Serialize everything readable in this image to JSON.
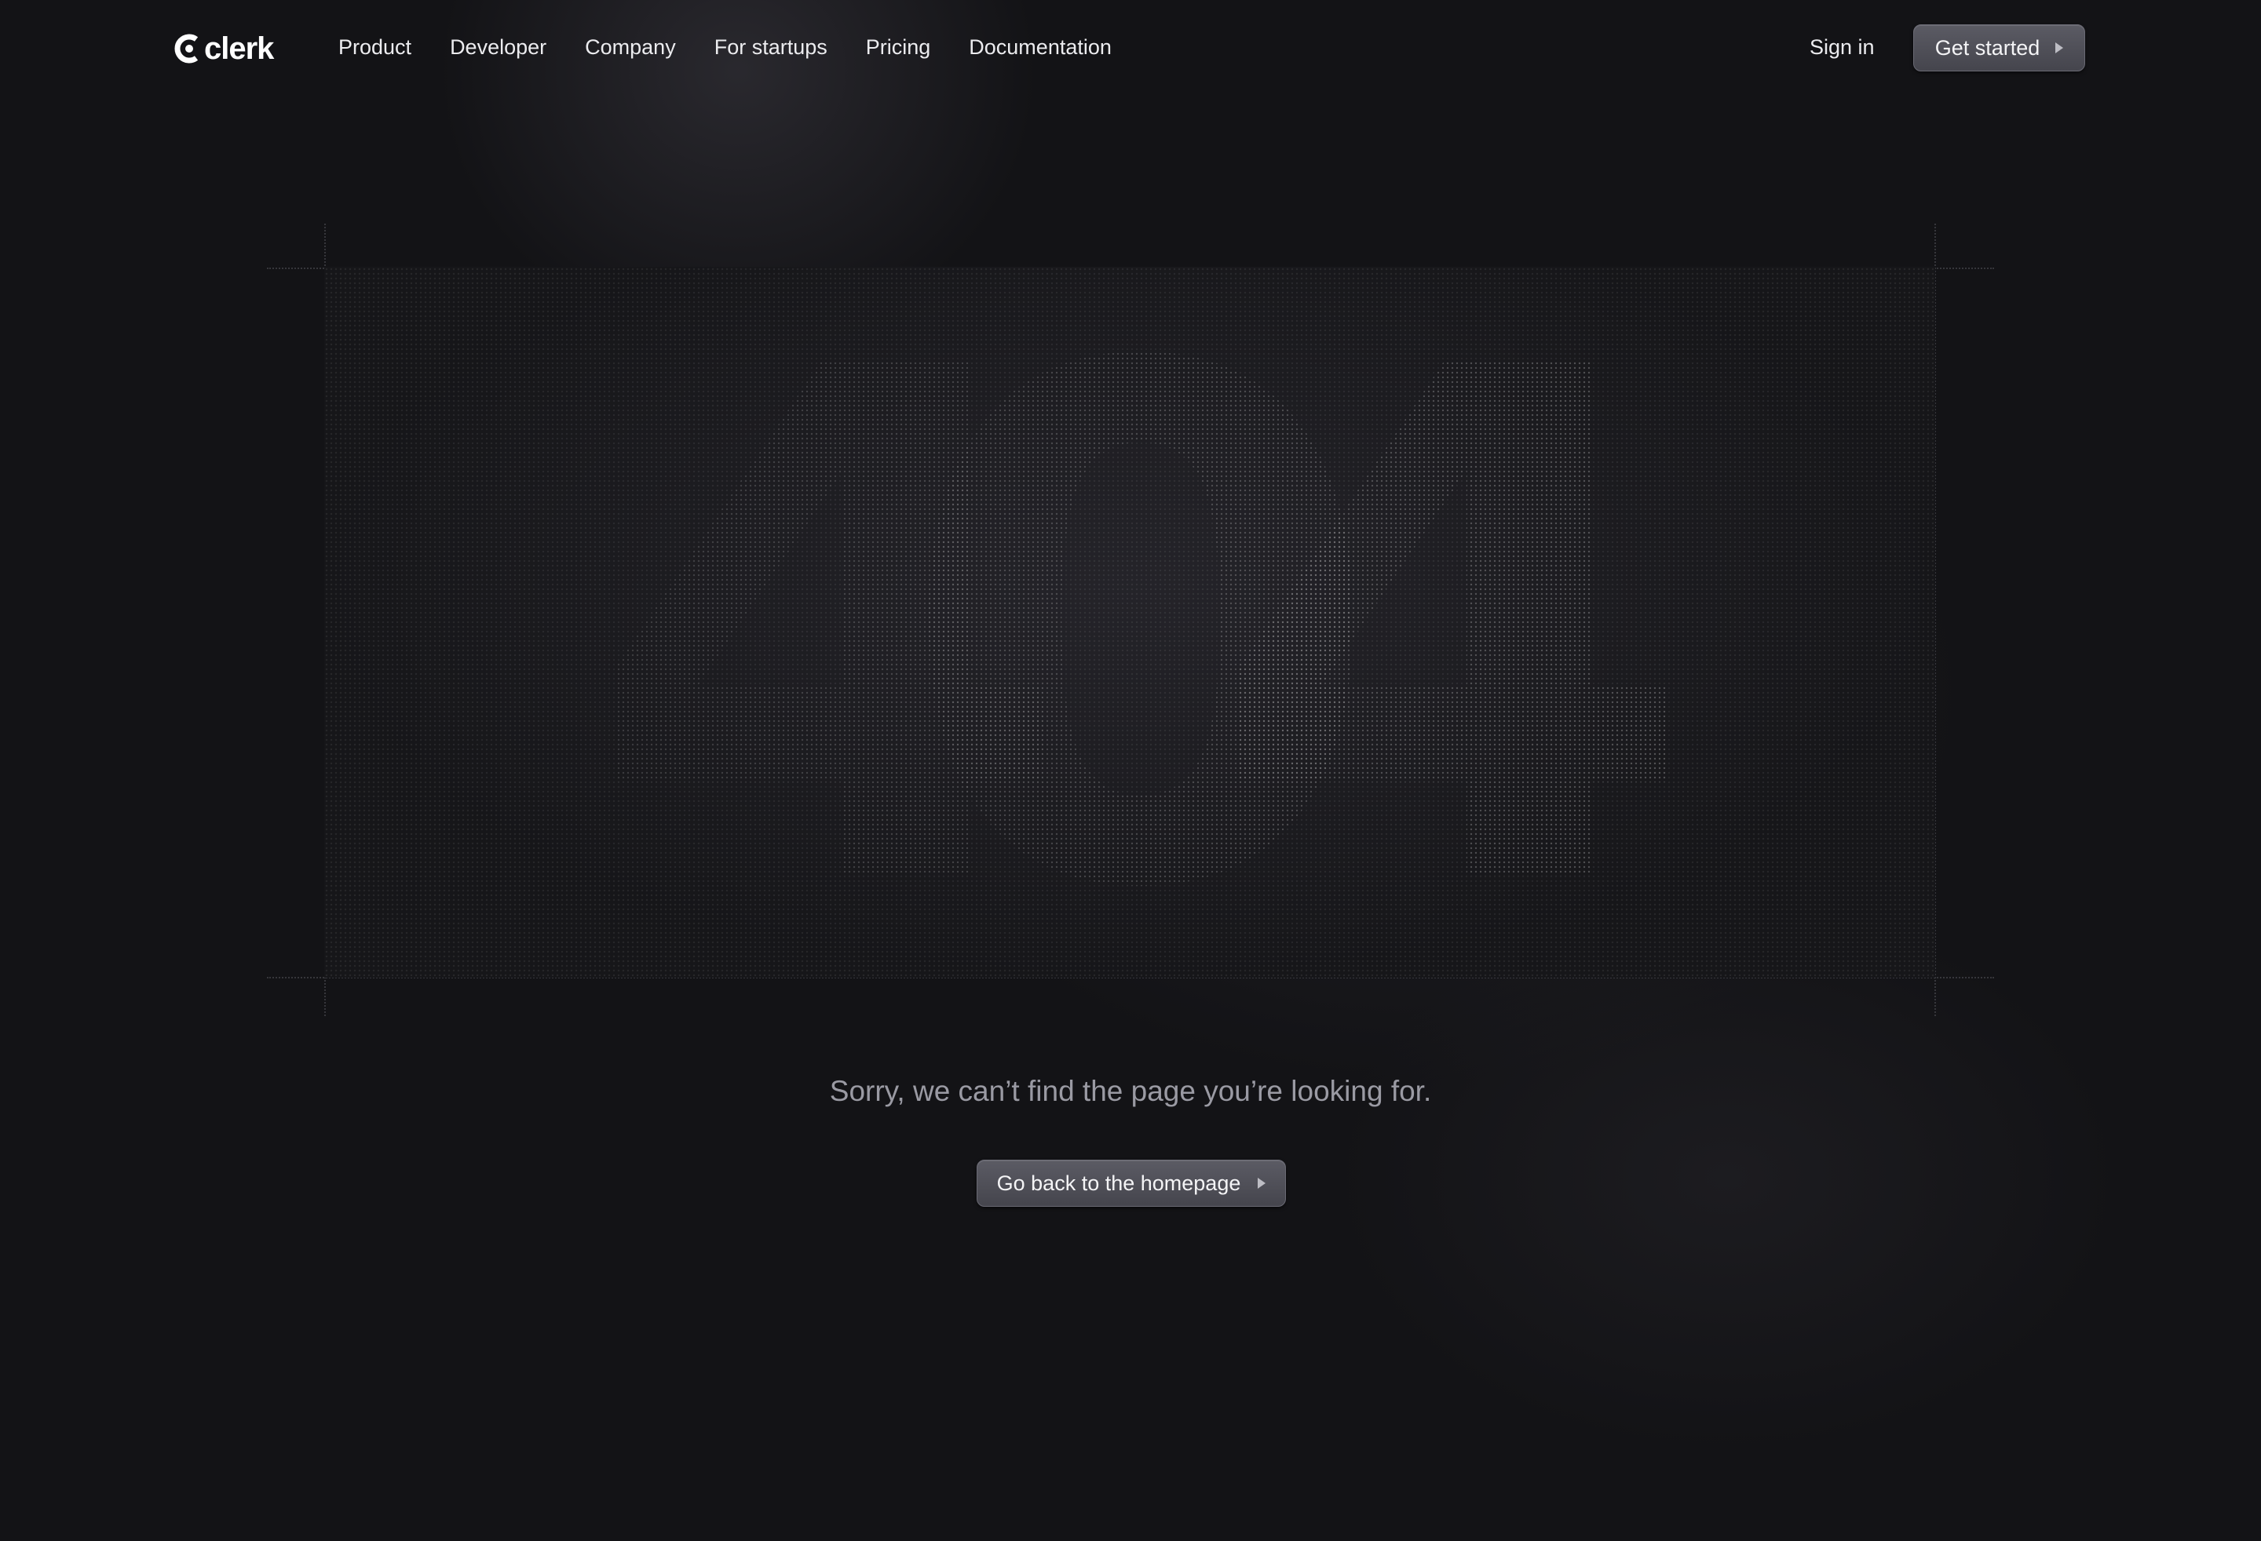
{
  "brand": {
    "name": "clerk",
    "logo_icon": "clerk-logo-icon"
  },
  "nav": {
    "items": [
      {
        "label": "Product"
      },
      {
        "label": "Developer"
      },
      {
        "label": "Company"
      },
      {
        "label": "For startups"
      },
      {
        "label": "Pricing"
      },
      {
        "label": "Documentation"
      }
    ]
  },
  "auth": {
    "sign_in_label": "Sign in",
    "get_started_label": "Get started"
  },
  "hero": {
    "code": "404"
  },
  "error": {
    "message": "Sorry, we can’t find the page you’re looking for.",
    "home_button_label": "Go back to the homepage"
  },
  "colors": {
    "background": "#131316",
    "button_bg": "#4f4f57",
    "muted_text": "#9a9aa3"
  }
}
